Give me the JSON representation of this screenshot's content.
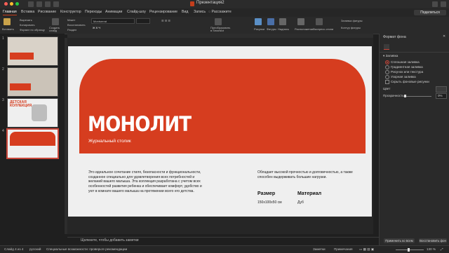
{
  "window": {
    "title": "Презентация2"
  },
  "menu": {
    "tabs": [
      "Главная",
      "Вставка",
      "Рисование",
      "Конструктор",
      "Переходы",
      "Анимации",
      "Слайд-шоу",
      "Рецензирование",
      "Вид",
      "Запись",
      "Расскажите"
    ],
    "share": "Поделиться"
  },
  "ribbon": {
    "paste": "Вставить",
    "cut": "Вырезать",
    "copy": "Копировать",
    "format_painter": "Формат по образцу",
    "new_slide": "Создать слайд",
    "layout": "Макет",
    "reset": "Восстановить",
    "section": "Раздел",
    "font_name": "Montserrat",
    "convert_smartart": "Преобразовать в SmartArt",
    "picture": "Рисунки",
    "shapes": "Фигуры",
    "textbox": "Надпись",
    "arrange": "Расположение",
    "quick_styles": "Экспресс-стили",
    "shape_fill": "Заливка фигуры",
    "shape_outline": "Контур фигуры"
  },
  "thumbnails": [
    {
      "num": "1",
      "title": "",
      "selected": false
    },
    {
      "num": "2",
      "title": "",
      "selected": false
    },
    {
      "num": "3",
      "title": "ДЕТСКАЯ КОЛЛЕКЦИЯ",
      "selected": false
    },
    {
      "num": "4",
      "title": "",
      "selected": true
    }
  ],
  "slide": {
    "brand": "МОНОЛИТ",
    "subtitle": "Журнальный столик",
    "description": "Это идеальное сочетание стиля, безопасности и функциональности, созданное специально для удовлетворения всех потребностей и желаний вашего малыша. Эта коллекция разработана с учетом всех особенностей развития ребенка и обеспечивает комфорт, удобство и уют в комнате вашего малыша на протяжении всего его детства.",
    "quality": "Обладает высокой прочностью и долговечностью, а также способен выдерживать большие нагрузки.",
    "size_label": "Размер",
    "size_value": "150х100х50 см",
    "material_label": "Материал",
    "material_value": "Дуб",
    "accent_color": "#d63d1f"
  },
  "notes": {
    "placeholder": "Щелкните, чтобы добавить заметки"
  },
  "panel": {
    "title": "Формат фона",
    "section": "Заливка",
    "options": [
      "Сплошная заливка",
      "Градиентная заливка",
      "Рисунок или текстура",
      "Узорная заливка"
    ],
    "selected_option": 0,
    "hide_bg": "Скрыть фоновые рисунки",
    "color_label": "Цвет",
    "transparency_label": "Прозрачность",
    "transparency_value": "0%",
    "apply_all": "Применить ко всем",
    "reset_bg": "Восстановить фон"
  },
  "status": {
    "slide_counter": "Слайд 4 из 4",
    "language": "русский",
    "accessibility": "Специальные возможности: проверьте рекомендации",
    "notes": "Заметки",
    "comments": "Примечания",
    "zoom": "130 %"
  }
}
